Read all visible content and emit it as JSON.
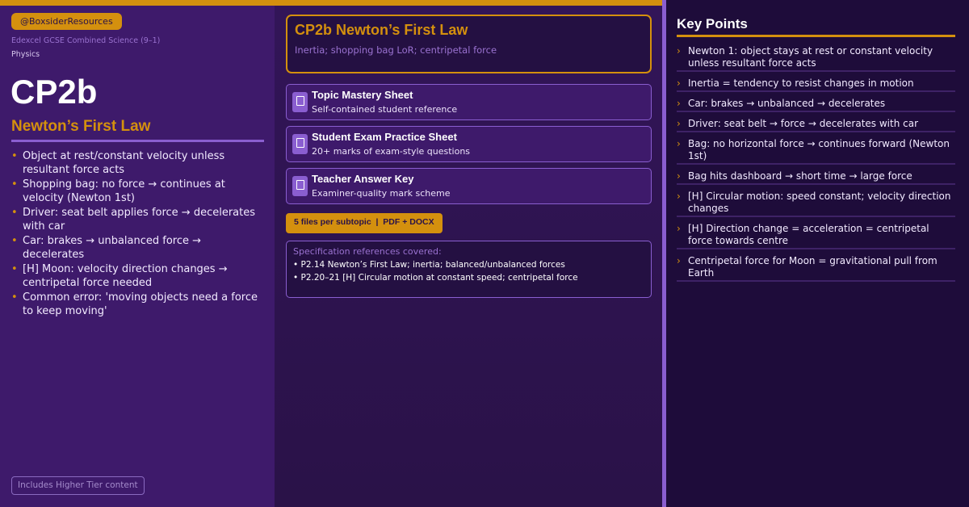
{
  "header": {
    "handle": "@BoxsiderResources",
    "exam_board": "Edexcel GCSE Combined Science (9–1)",
    "subject": "Physics"
  },
  "topic": {
    "code": "CP2b",
    "title": "Newton’s First Law",
    "full_title": "CP2b Newton’s First Law",
    "subtitle": "Inertia; shopping bag LoR; centripetal force"
  },
  "left_points": [
    "Object at rest/constant velocity unless resultant force acts",
    "Shopping bag: no force → continues at velocity (Newton 1st)",
    "Driver: seat belt applies force → decelerates with car",
    "Car: brakes → unbalanced force → decelerates",
    "[H] Moon: velocity direction changes → centripetal force needed",
    "Common error: 'moving objects need a force to keep moving'"
  ],
  "higher_tier_label": "Includes Higher Tier content",
  "files": [
    {
      "title": "Topic Mastery Sheet",
      "desc": "Self-contained student reference",
      "icon": "document-icon"
    },
    {
      "title": "Student Exam Practice Sheet",
      "desc": "20+ marks of exam-style questions",
      "icon": "document-icon"
    },
    {
      "title": "Teacher Answer Key",
      "desc": "Examiner-quality mark scheme",
      "icon": "document-icon"
    }
  ],
  "files_badge": "5 files per subtopic  |  PDF + DOCX",
  "spec": {
    "heading": "Specification references covered:",
    "lines": [
      "• P2.14  Newton’s First Law; inertia; balanced/unbalanced forces",
      "• P2.20–21  [H] Circular motion at constant speed; centripetal force"
    ]
  },
  "key_points": {
    "title": "Key Points",
    "items": [
      "Newton 1: object stays at rest or constant velocity unless resultant force acts",
      "Inertia = tendency to resist changes in motion",
      "Car: brakes → unbalanced → decelerates",
      "Driver: seat belt → force → decelerates with car",
      "Bag: no horizontal force → continues forward (Newton 1st)",
      "Bag hits dashboard → short time → large force",
      "[H] Circular motion: speed constant; velocity direction changes",
      "[H] Direction change = acceleration = centripetal force towards centre",
      "Centripetal force for Moon = gravitational pull from Earth"
    ]
  },
  "colors": {
    "accent": "#d4900e",
    "purple_light": "#8a5ed0",
    "panel_left": "#3e1a6b",
    "panel_right": "#1e0c3a"
  }
}
